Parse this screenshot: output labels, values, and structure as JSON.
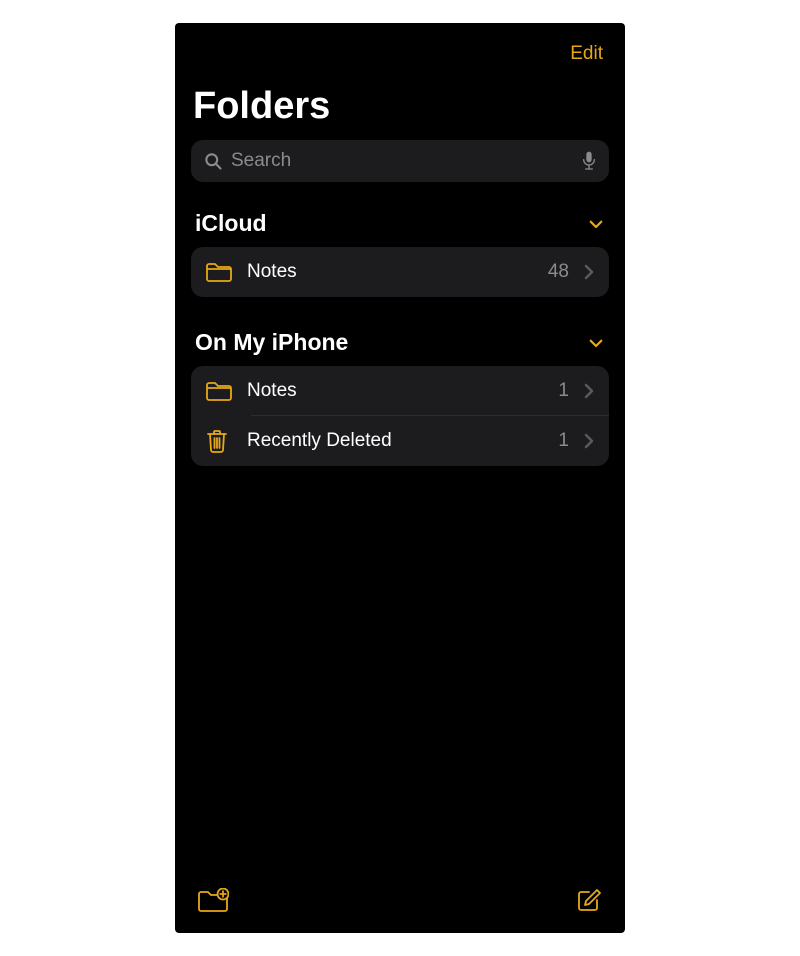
{
  "topbar": {
    "edit_label": "Edit"
  },
  "page": {
    "title": "Folders"
  },
  "search": {
    "placeholder": "Search"
  },
  "sections": [
    {
      "title": "iCloud",
      "rows": [
        {
          "icon": "folder",
          "label": "Notes",
          "count": "48"
        }
      ]
    },
    {
      "title": "On My iPhone",
      "rows": [
        {
          "icon": "folder",
          "label": "Notes",
          "count": "1"
        },
        {
          "icon": "trash",
          "label": "Recently Deleted",
          "count": "1"
        }
      ]
    }
  ],
  "colors": {
    "accent": "#e6a817",
    "bg": "#000000",
    "panel": "#1c1c1e",
    "secondaryText": "#8b8b8d"
  }
}
